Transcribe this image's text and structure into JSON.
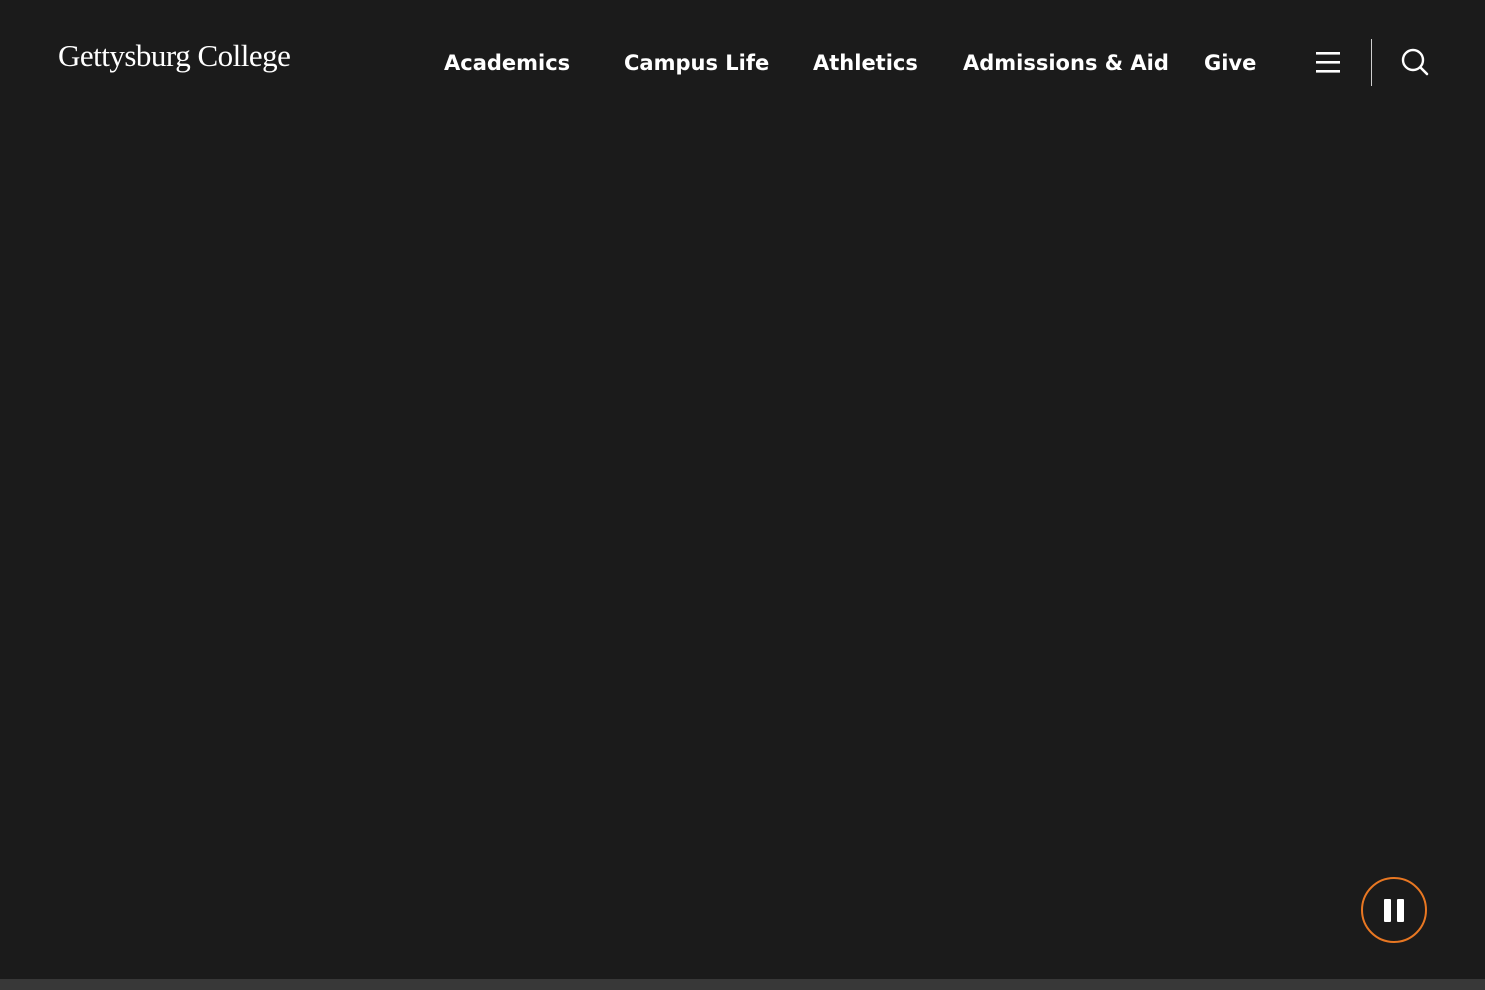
{
  "header": {
    "logo_text": "Gettysburg College",
    "nav": [
      {
        "label": "Academics"
      },
      {
        "label": "Campus Life"
      },
      {
        "label": "Athletics"
      },
      {
        "label": "Admissions & Aid"
      },
      {
        "label": "Give"
      }
    ],
    "menu_icon": "hamburger-menu-icon",
    "search_icon": "search-icon"
  },
  "hero": {
    "pause_icon": "pause-icon"
  },
  "colors": {
    "background": "#1b1b1b",
    "accent": "#e87722",
    "text": "#ffffff",
    "bottom_strip": "#383838"
  }
}
